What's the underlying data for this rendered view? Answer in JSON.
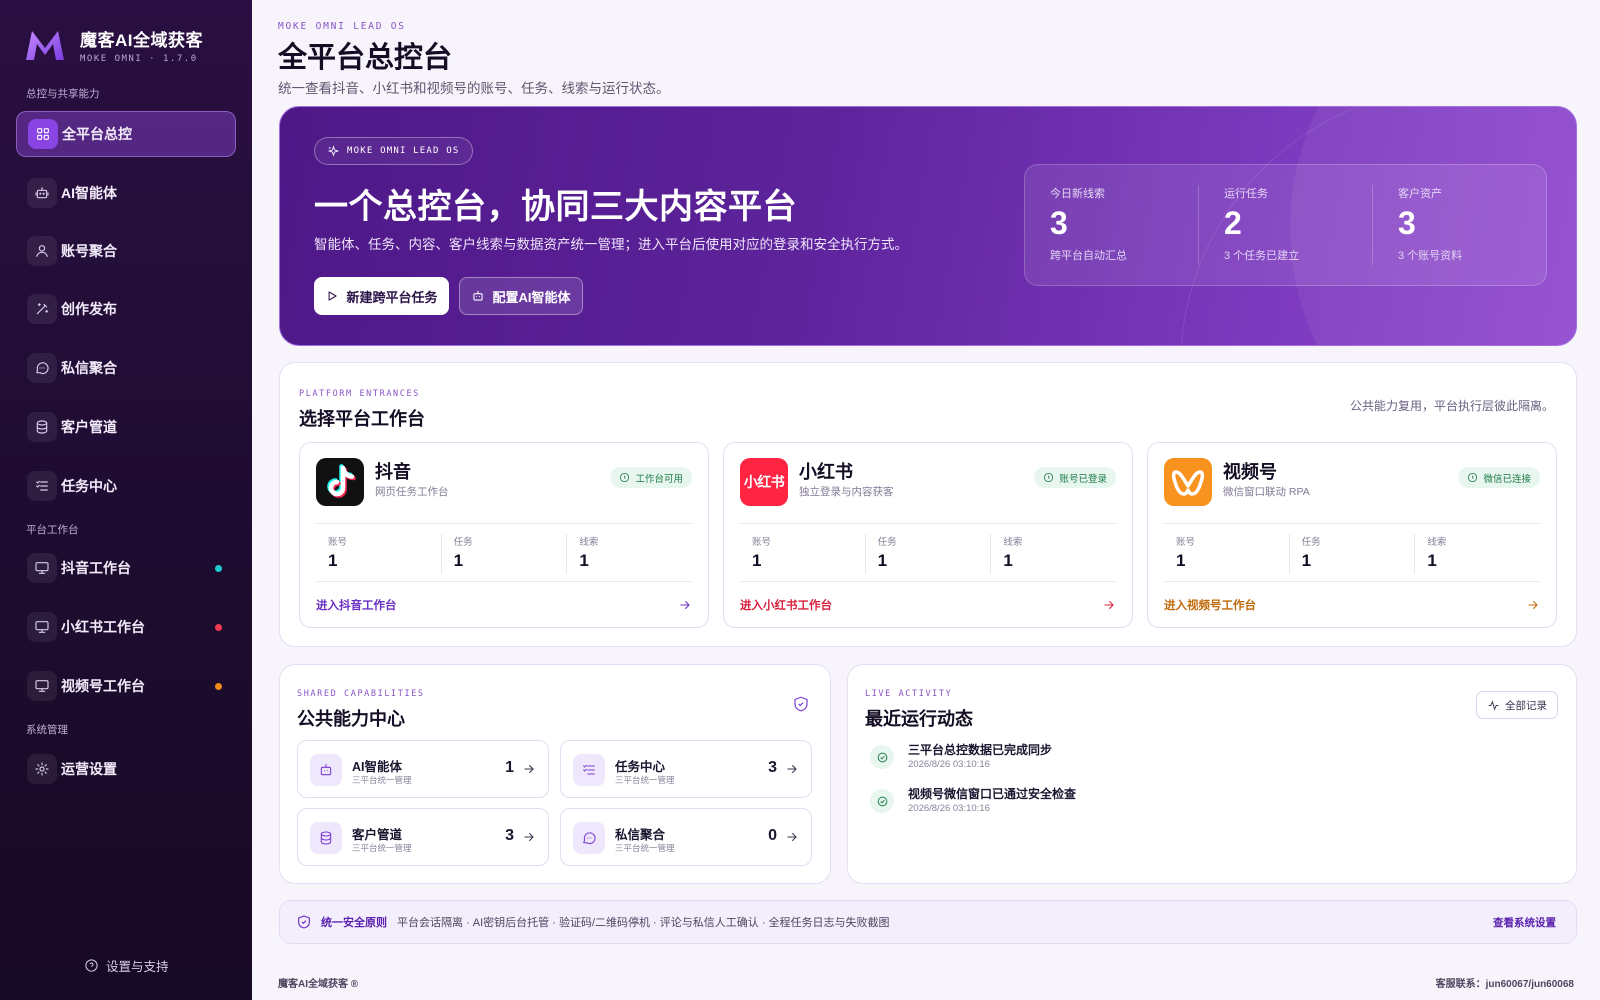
{
  "brand": {
    "name": "魔客AI全域获客",
    "subtitle": "MOKE OMNI · 1.7.0"
  },
  "sidebar": {
    "section_core": "总控与共享能力",
    "section_platforms": "平台工作台",
    "section_system": "系统管理",
    "items": [
      {
        "label": "全平台总控",
        "icon": "grid-icon",
        "active": true
      },
      {
        "label": "AI智能体",
        "icon": "bot-icon"
      },
      {
        "label": "账号聚合",
        "icon": "user-icon"
      },
      {
        "label": "创作发布",
        "icon": "wand-icon"
      },
      {
        "label": "私信聚合",
        "icon": "message-icon"
      },
      {
        "label": "客户管道",
        "icon": "database-icon"
      },
      {
        "label": "任务中心",
        "icon": "list-icon"
      },
      {
        "label": "抖音工作台",
        "icon": "monitor-icon",
        "dot": "#1fc9d0"
      },
      {
        "label": "小红书工作台",
        "icon": "monitor-icon",
        "dot": "#ee3a52"
      },
      {
        "label": "视频号工作台",
        "icon": "monitor-icon",
        "dot": "#f28a1c"
      },
      {
        "label": "运营设置",
        "icon": "gear-icon"
      }
    ],
    "support": "设置与支持"
  },
  "header": {
    "eyebrow": "MOKE OMNI LEAD OS",
    "title": "全平台总控台",
    "desc": "统一查看抖音、小红书和视频号的账号、任务、线索与运行状态。"
  },
  "hero": {
    "badge": "MOKE OMNI LEAD OS",
    "title": "一个总控台，协同三大内容平台",
    "desc": "智能体、任务、内容、客户线索与数据资产统一管理；进入平台后使用对应的登录和安全执行方式。",
    "btn_primary": "新建跨平台任务",
    "btn_secondary": "配置AI智能体",
    "stats": [
      {
        "label": "今日新线索",
        "value": "3",
        "sub": "跨平台自动汇总"
      },
      {
        "label": "运行任务",
        "value": "2",
        "sub": "3 个任务已建立"
      },
      {
        "label": "客户资产",
        "value": "3",
        "sub": "3 个账号资料"
      }
    ]
  },
  "platforms": {
    "eyebrow": "PLATFORM ENTRANCES",
    "title": "选择平台工作台",
    "note": "公共能力复用，平台执行层彼此隔离。",
    "stat_labels": [
      "账号",
      "任务",
      "线索"
    ],
    "cards": [
      {
        "name": "抖音",
        "sub": "网页任务工作台",
        "badge": "工作台可用",
        "values": [
          "1",
          "1",
          "1"
        ],
        "link": "进入抖音工作台",
        "accent": "#6a2fc4"
      },
      {
        "name": "小红书",
        "sub": "独立登录与内容获客",
        "badge": "账号已登录",
        "values": [
          "1",
          "1",
          "1"
        ],
        "link": "进入小红书工作台",
        "accent": "#d9213f",
        "logo_text": "小红书"
      },
      {
        "name": "视频号",
        "sub": "微信窗口联动 RPA",
        "badge": "微信已连接",
        "values": [
          "1",
          "1",
          "1"
        ],
        "link": "进入视频号工作台",
        "accent": "#c0690a"
      }
    ]
  },
  "shared": {
    "eyebrow": "SHARED CAPABILITIES",
    "title": "公共能力中心",
    "items": [
      {
        "name": "AI智能体",
        "sub": "三平台统一管理",
        "value": "1",
        "icon": "bot-icon"
      },
      {
        "name": "任务中心",
        "sub": "三平台统一管理",
        "value": "3",
        "icon": "list-icon"
      },
      {
        "name": "客户管道",
        "sub": "三平台统一管理",
        "value": "3",
        "icon": "database-icon"
      },
      {
        "name": "私信聚合",
        "sub": "三平台统一管理",
        "value": "0",
        "icon": "message-icon"
      }
    ]
  },
  "activity": {
    "eyebrow": "LIVE ACTIVITY",
    "title": "最近运行动态",
    "all_btn": "全部记录",
    "items": [
      {
        "title": "三平台总控数据已完成同步",
        "time": "2026/8/26 03:10:16"
      },
      {
        "title": "视频号微信窗口已通过安全检查",
        "time": "2026/8/26 03:10:16"
      }
    ]
  },
  "notice": {
    "label": "统一安全原则",
    "text": "平台会话隔离 · AI密钥后台托管 · 验证码/二维码停机 · 评论与私信人工确认 · 全程任务日志与失败截图",
    "link": "查看系统设置"
  },
  "footer": {
    "left": "魔客AI全域获客 ®",
    "right": "客服联系：jun60067/jun60068"
  }
}
